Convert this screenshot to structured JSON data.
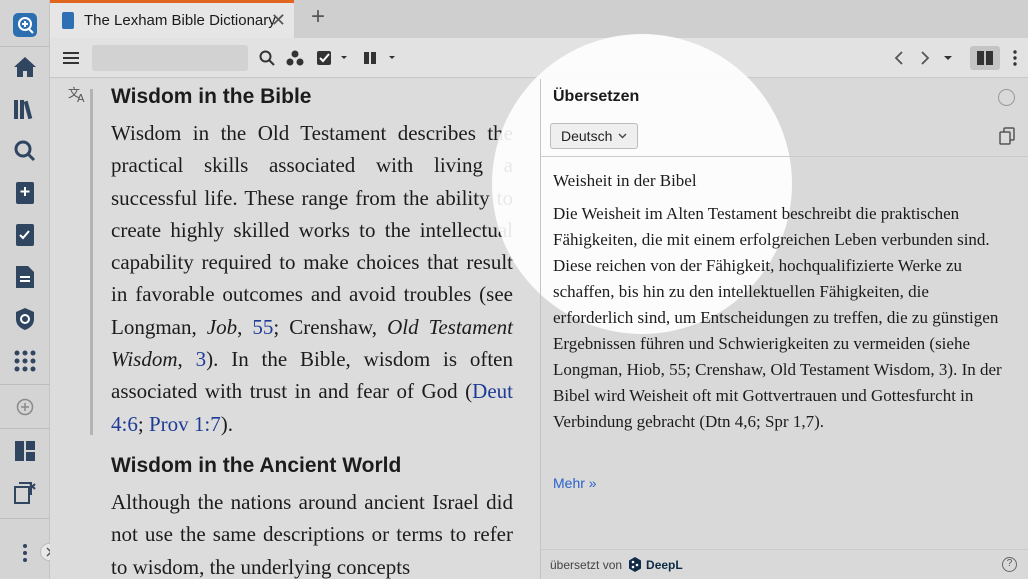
{
  "tab": {
    "title": "The Lexham Bible Dictionary",
    "close": "✕",
    "add": "+"
  },
  "toolbar": {
    "search_value": ""
  },
  "article": {
    "heading1": "Wisdom in the Bible",
    "p1_a": "Wisdom in the Old Testament describes the practical skills associated with living a successful life. These range from the ability to create highly skilled works to the intellectual capability required to make choices that result in favorable outcomes and avoid troubles (see Longman, ",
    "p1_job": "Job",
    "p1_b": ", ",
    "p1_55": "55",
    "p1_c": "; Crenshaw, ",
    "p1_otw": "Old Testament Wisdom",
    "p1_d": ", ",
    "p1_3": "3",
    "p1_e": "). In the Bible, wisdom is often associated with trust in and fear of God (",
    "p1_deut": "Deut 4:6",
    "p1_f": "; ",
    "p1_prov": "Prov 1:7",
    "p1_g": ").",
    "heading2": "Wisdom in the Ancient World",
    "p2": "Although the nations around ancient Israel did not use the same descriptions or terms to refer to wisdom, the underlying concepts"
  },
  "translate": {
    "title": "Übersetzen",
    "language": "Deutsch",
    "result_title": "Weisheit in der Bibel",
    "result_text": "Die Weisheit im Alten Testament beschreibt die praktischen Fähigkeiten, die mit einem erfolgreichen Leben verbunden sind. Diese reichen von der Fähigkeit, hochqualifizierte Werke zu schaffen, bis hin zu den intellektuellen Fähigkeiten, die erforderlich sind, um Entscheidungen zu treffen, die zu günstigen Ergebnissen führen und Schwierigkeiten zu vermeiden (siehe Longman, Hiob, 55; Crenshaw, Old Testament Wisdom, 3). In der Bibel wird Weisheit oft mit Gottvertrauen und Gottesfurcht in Verbindung gebracht (Dtn 4,6; Spr 1,7).",
    "more": "Mehr »",
    "footer": "übersetzt von",
    "provider": "DeepL",
    "help": "?"
  },
  "colors": {
    "accent": "#e0661f",
    "link": "#1e3b96",
    "more": "#2a62c9"
  }
}
